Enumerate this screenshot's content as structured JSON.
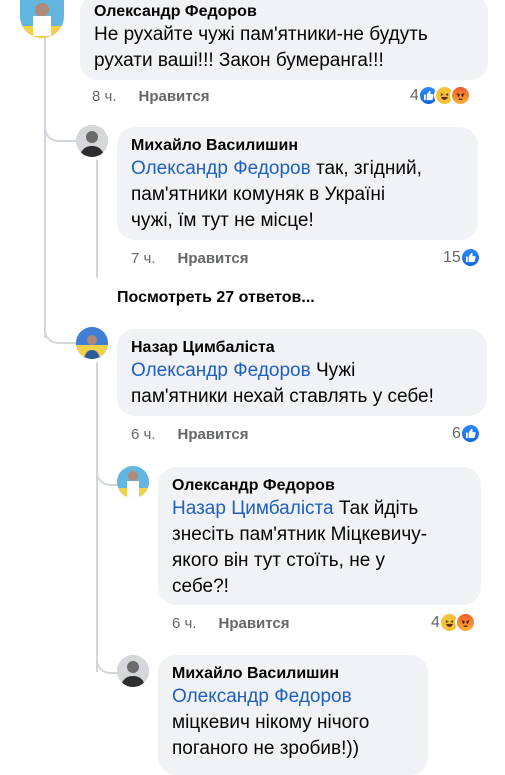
{
  "c1": {
    "name": "Олександр Федоров",
    "lines": [
      "Не рухайте чужі пам'ятники-не будуть",
      "рухати ваші!!! Закон бумеранга!!!"
    ],
    "time": "8 ч.",
    "like": "Нравится",
    "reactions_count": "4"
  },
  "c2": {
    "name": "Михайло Василишин",
    "mention": "Олександр Федоров",
    "after_mention": " так, згідний,",
    "lines": [
      "пам'ятники комуняк в Україні",
      "чужі, їм тут не місце!"
    ],
    "time": "7 ч.",
    "like": "Нравится",
    "reactions_count": "15"
  },
  "view_more": "Посмотреть 27 ответов...",
  "c3": {
    "name": "Назар Цимбаліста",
    "mention": "Олександр Федоров",
    "after_mention": " Чужі",
    "lines": [
      "пам'ятники нехай ставлять у себе!"
    ],
    "time": "6 ч.",
    "like": "Нравится",
    "reactions_count": "6"
  },
  "c4": {
    "name": "Олександр Федоров",
    "mention": "Назар Цимбаліста",
    "after_mention": " Так йдіть",
    "lines": [
      "знесіть пам'ятник Міцкевичу-",
      "якого він тут стоїть, не у",
      "себе?!"
    ],
    "time": "6 ч.",
    "like": "Нравится",
    "reactions_count": "4"
  },
  "c5": {
    "name": "Михайло Василишин",
    "mention": "Олександр Федоров",
    "lines": [
      "міцкевич нікому нічого",
      "поганого не зробив!))"
    ]
  },
  "colors": {
    "bubble": "#f0f2f5",
    "mention": "#1f5fbf",
    "meta": "#65676b",
    "like_blue": "#1877f2"
  },
  "icons": {
    "like": "thumbs-up-icon",
    "haha": "laughing-emoji-icon",
    "angry": "angry-emoji-icon"
  }
}
